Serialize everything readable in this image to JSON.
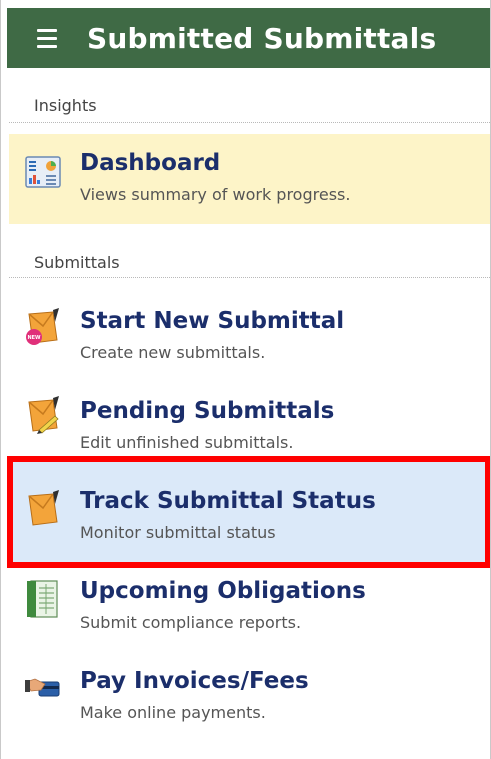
{
  "header": {
    "title": "Submitted Submittals"
  },
  "sections": {
    "insights": "Insights",
    "submittals": "Submittals"
  },
  "items": {
    "dashboard": {
      "title": "Dashboard",
      "desc": "Views summary of work progress.",
      "icon": "dashboard-icon"
    },
    "start_new": {
      "title": "Start New Submittal",
      "desc": "Create new submittals.",
      "icon": "new-envelope-icon"
    },
    "pending": {
      "title": "Pending Submittals",
      "desc": "Edit unfinished submittals.",
      "icon": "pending-envelope-icon"
    },
    "track": {
      "title": "Track Submittal Status",
      "desc": "Monitor submittal status",
      "icon": "track-envelope-icon"
    },
    "obligations": {
      "title": "Upcoming Obligations",
      "desc": "Submit compliance reports.",
      "icon": "ledger-icon"
    },
    "pay": {
      "title": "Pay Invoices/Fees",
      "desc": "Make online payments.",
      "icon": "payment-card-icon"
    }
  },
  "colors": {
    "header_bg": "#3f6a45",
    "title_text": "#1b2e6b",
    "dashboard_bg": "#fdf4c8",
    "selected_bg": "#dbe9f9",
    "highlight_border": "#ff0000"
  },
  "annotations": {
    "highlighted_item": "track"
  }
}
